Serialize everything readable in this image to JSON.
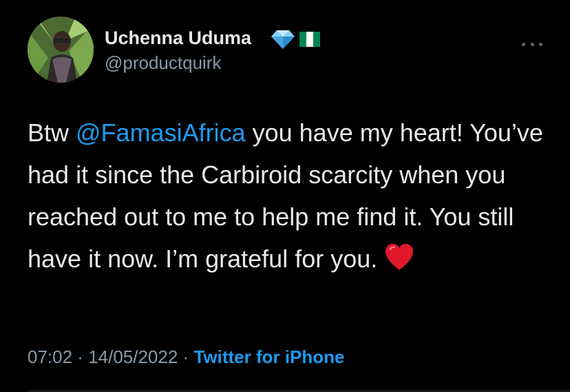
{
  "user": {
    "display_name": "Uchenna Uduma",
    "handle": "@productquirk"
  },
  "badges": [
    {
      "icon": "diamond-icon",
      "glyph": "💎"
    },
    {
      "icon": "nigeria-flag-icon",
      "colors": [
        "#008751",
        "#ffffff",
        "#008751"
      ]
    }
  ],
  "tweet": {
    "lead": "Btw ",
    "mention": "@FamasiAfrica",
    "body": " you have my heart! You’ve had it since the Carbiroid scarcity when you reached out to me to help me find it. You still have it now. I’m grateful for you.",
    "emoji": "red-heart-icon"
  },
  "meta": {
    "time": "07:02",
    "separator": " · ",
    "date": "14/05/2022",
    "source": "Twitter for iPhone"
  },
  "colors": {
    "background": "#000000",
    "text": "#e7e9ea",
    "secondary": "#8b98a5",
    "link": "#1d9bf0"
  }
}
